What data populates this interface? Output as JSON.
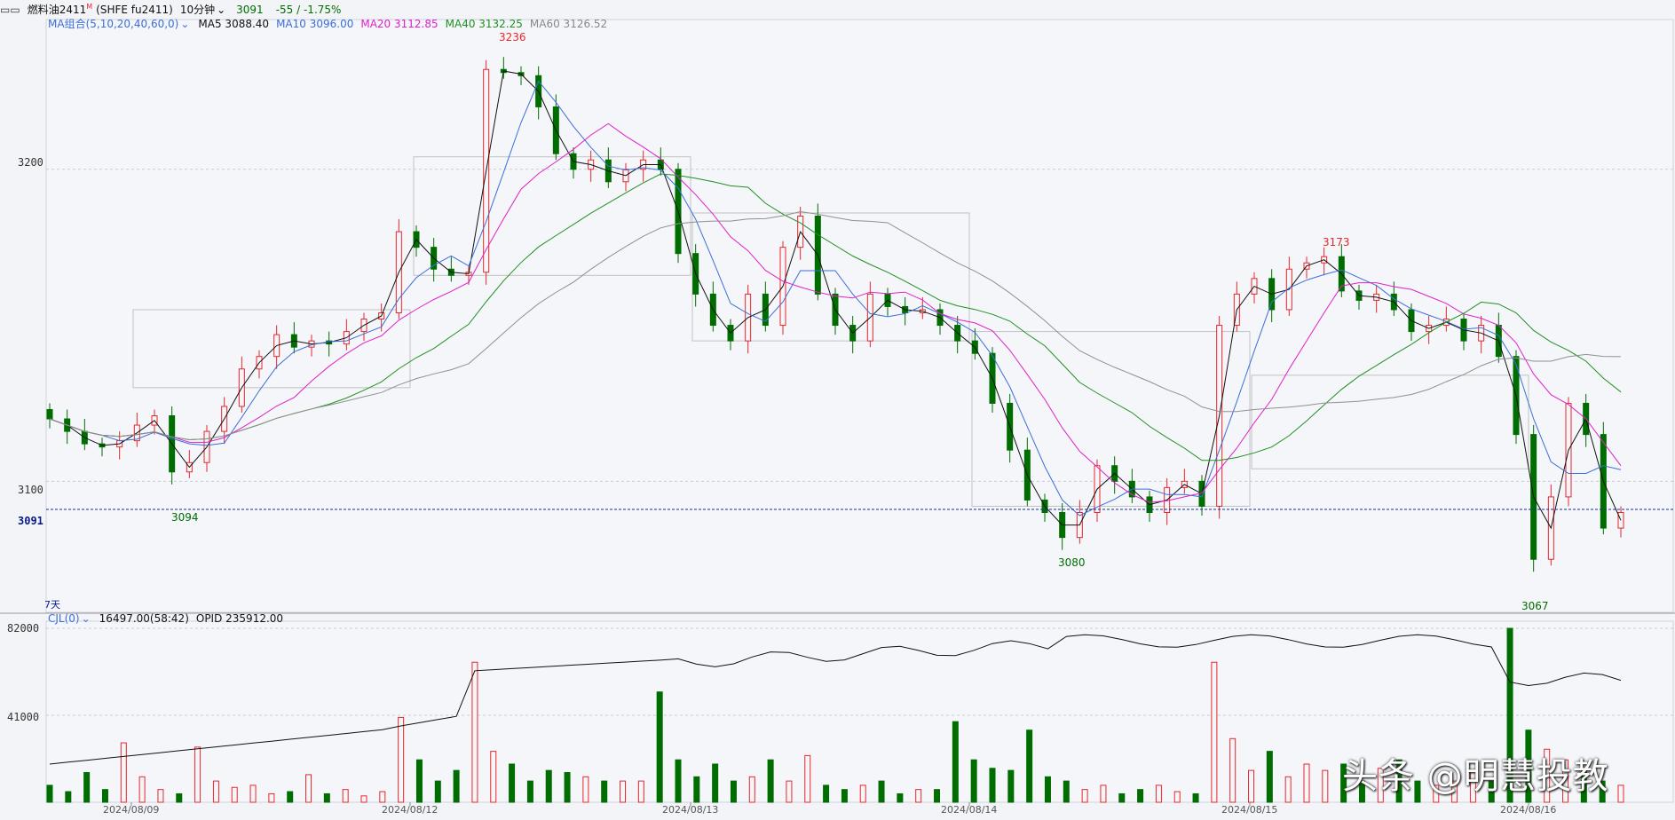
{
  "header": {
    "window_icon": "chart-window-icon",
    "contract": "燃料油2411",
    "contract_mark": "M",
    "code": "(SHFE fu2411)",
    "period": "10分钟",
    "price": "3091",
    "change": "-55 / -1.75%",
    "ma_group_label": "MA组合(5,10,20,40,60,0)",
    "ma5": "MA5 3088.40",
    "ma10": "MA10 3096.00",
    "ma20": "MA20 3112.85",
    "ma40": "MA40 3132.25",
    "ma60": "MA60 3126.52"
  },
  "indicator": {
    "label": "CJL(0)",
    "values": "16497.00(58:42)",
    "opid": "OPID 235912.00"
  },
  "price_axis": {
    "ticks": [
      "3200",
      "3100"
    ],
    "current": "3091"
  },
  "volume_axis": {
    "ticks": [
      "82000",
      "41000"
    ]
  },
  "x_axis": {
    "dates": [
      "2024/08/09",
      "2024/08/12",
      "2024/08/13",
      "2024/08/14",
      "2024/08/15",
      "2024/08/16"
    ]
  },
  "annotations": {
    "high1": "3236",
    "high2": "3173",
    "low1": "3094",
    "low2": "3080",
    "low3": "3067",
    "days": "7天"
  },
  "watermark": "头条 @明慧投教",
  "colors": {
    "up": "#e8262a",
    "down": "#006d00",
    "ma5": "#111111",
    "ma10": "#3a6fd8",
    "ma20": "#e020c8",
    "ma40": "#209020",
    "ma60": "#909090",
    "oi": "#111111"
  },
  "chart_data": [
    {
      "type": "candlestick",
      "title": "燃料油2411 (SHFE fu2411) 10分钟",
      "ylim": [
        3058,
        3248
      ],
      "legend": [
        "MA5 3088.40",
        "MA10 3096.00",
        "MA20 3112.85",
        "MA40 3132.25",
        "MA60 3126.52"
      ],
      "x": [
        "2024/08/09",
        "2024/08/12",
        "2024/08/13",
        "2024/08/14",
        "2024/08/15",
        "2024/08/16"
      ],
      "series_close": [
        3120,
        3116,
        3112,
        3111,
        3113,
        3118,
        3121,
        3103,
        3106,
        3116,
        3124,
        3136,
        3140,
        3147,
        3143,
        3145,
        3144,
        3148,
        3152,
        3154,
        3180,
        3175,
        3168,
        3166,
        3167,
        3232,
        3231,
        3230,
        3220,
        3205,
        3200,
        3203,
        3196,
        3200,
        3203,
        3200,
        3173,
        3160,
        3150,
        3145,
        3160,
        3150,
        3175,
        3185,
        3160,
        3150,
        3145,
        3160,
        3156,
        3154,
        3155,
        3150,
        3145,
        3141,
        3125,
        3110,
        3094,
        3090,
        3082,
        3090,
        3105,
        3100,
        3095,
        3090,
        3098,
        3100,
        3092,
        3150,
        3160,
        3165,
        3155,
        3168,
        3170,
        3172,
        3161,
        3158,
        3160,
        3155,
        3148,
        3150,
        3152,
        3145,
        3150,
        3140,
        3115,
        3075,
        3095,
        3125,
        3115,
        3085,
        3090
      ],
      "volume": [
        8000,
        5000,
        14000,
        6000,
        28000,
        12000,
        6000,
        4000,
        26000,
        10000,
        7000,
        8000,
        4000,
        5000,
        13000,
        4000,
        6000,
        3000,
        5000,
        40000,
        20000,
        10000,
        15000,
        66000,
        24000,
        18000,
        10000,
        15000,
        14000,
        12000,
        10000,
        10000,
        10000,
        52000,
        20000,
        12000,
        18000,
        10000,
        12000,
        20000,
        10000,
        22000,
        8000,
        6000,
        8000,
        10000,
        4000,
        6000,
        6000,
        38000,
        20000,
        16000,
        15000,
        34000,
        12000,
        10000,
        6000,
        8000,
        4000,
        6000,
        8000,
        5000,
        4000,
        66000,
        30000,
        15000,
        24000,
        12000,
        18000,
        15000,
        18000,
        10000,
        16000,
        20000,
        10000,
        8000,
        10000,
        15000,
        10000,
        82000,
        34000,
        25000,
        20000,
        15000,
        10000,
        8000
      ],
      "open_interest_label": "OPID 235912.00"
    }
  ]
}
